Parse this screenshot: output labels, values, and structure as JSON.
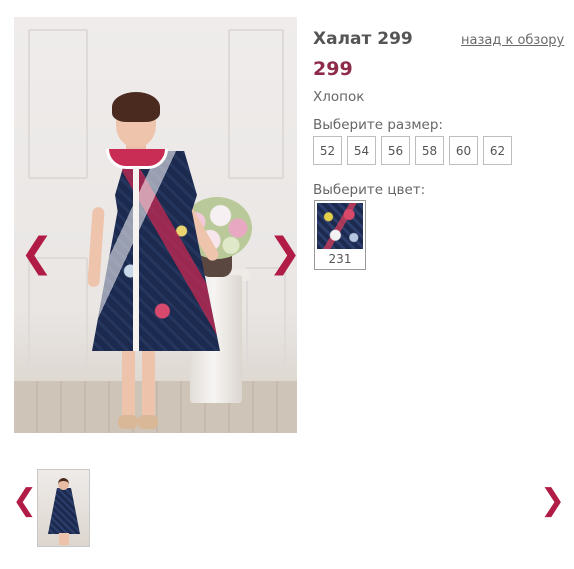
{
  "product": {
    "title": "Халат 299",
    "back_link": "назад к обзору",
    "price": "299",
    "material": "Хлопок"
  },
  "size_selector": {
    "label": "Выберите размер:",
    "sizes": [
      "52",
      "54",
      "56",
      "58",
      "60",
      "62"
    ]
  },
  "color_selector": {
    "label": "Выберите цвет:",
    "options": [
      {
        "code": "231"
      }
    ]
  },
  "gallery": {
    "prev_arrow": "❮",
    "next_arrow": "❯",
    "thumbnail_count": 1
  },
  "colors": {
    "accent": "#b01c46",
    "price": "#8e2a4a",
    "text": "#555555"
  },
  "icons": [
    "chevron-left-icon",
    "chevron-right-icon"
  ]
}
